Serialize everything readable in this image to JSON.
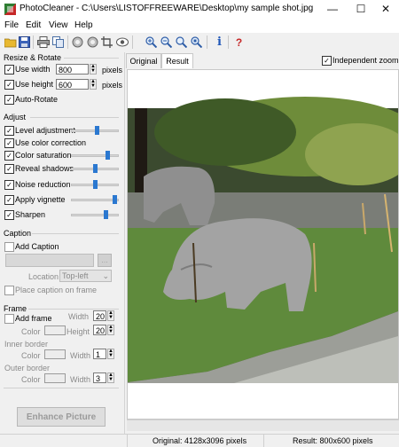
{
  "window": {
    "title": "PhotoCleaner - C:\\Users\\LISTOFFREEWARE\\Desktop\\my sample shot.jpg",
    "minimize_glyph": "—",
    "maximize_glyph": "☐",
    "close_glyph": "✕"
  },
  "menu": {
    "items": [
      "File",
      "Edit",
      "View",
      "Help"
    ]
  },
  "toolbar": {
    "icons": [
      "open-icon",
      "save-icon",
      "print-icon",
      "copy-icon",
      "rotate-left-icon",
      "rotate-right-icon",
      "crop-icon",
      "eye-icon",
      "zoom-in-icon",
      "zoom-out-icon",
      "zoom-fit-icon",
      "zoom-actual-icon",
      "info-icon",
      "help-icon"
    ],
    "info_glyph": "i",
    "help_glyph": "?"
  },
  "resize": {
    "section_title": "Resize & Rotate",
    "use_width_label": "Use width",
    "use_width_checked": true,
    "width_value": "800",
    "width_unit": "pixels",
    "use_height_label": "Use height",
    "use_height_checked": true,
    "height_value": "600",
    "height_unit": "pixels",
    "auto_rotate_label": "Auto-Rotate",
    "auto_rotate_checked": true
  },
  "adjust": {
    "section_title": "Adjust",
    "items": [
      {
        "label": "Level adjustment",
        "checked": true,
        "has_slider": true,
        "level": 0.55
      },
      {
        "label": "Use color correction",
        "checked": true,
        "has_slider": false
      },
      {
        "label": "Color saturation",
        "checked": true,
        "has_slider": true,
        "level": 0.8
      },
      {
        "label": "Reveal shadows",
        "checked": true,
        "has_slider": true,
        "level": 0.5
      },
      {
        "label": "Noise reduction",
        "checked": true,
        "has_slider": true,
        "level": 0.5
      },
      {
        "label": "Apply vignette",
        "checked": true,
        "has_slider": true,
        "level": 0.95
      },
      {
        "label": "Sharpen",
        "checked": true,
        "has_slider": true,
        "level": 0.75
      }
    ]
  },
  "caption": {
    "section_title": "Caption",
    "add_caption_label": "Add Caption",
    "add_caption_checked": false,
    "location_label": "Location",
    "location_value": "Top-left",
    "place_on_frame_label": "Place caption on frame",
    "place_on_frame_checked": false
  },
  "frame": {
    "section_title": "Frame",
    "add_frame_label": "Add frame",
    "add_frame_checked": false,
    "width_label": "Width",
    "width_value": "20",
    "color_label": "Color",
    "height_label": "Height",
    "height_value": "20",
    "inner_border_label": "Inner border",
    "inner_color_label": "Color",
    "inner_width_label": "Width",
    "inner_width_value": "1",
    "outer_border_label": "Outer border",
    "outer_color_label": "Color",
    "outer_width_label": "Width",
    "outer_width_value": "3"
  },
  "enhance_button": "Enhance Picture",
  "tabs": {
    "original": "Original",
    "result": "Result",
    "active": "Result"
  },
  "independent_zoom": {
    "label": "Independent zoom",
    "checked": true
  },
  "status": {
    "original": "Original: 4128x3096 pixels",
    "result": "Result: 800x600 pixels"
  },
  "colors": {
    "accent": "#2b78d0",
    "sky": "#2d3a2a",
    "grass": "#5f8a3c",
    "rhino": "#9a9a9a"
  }
}
